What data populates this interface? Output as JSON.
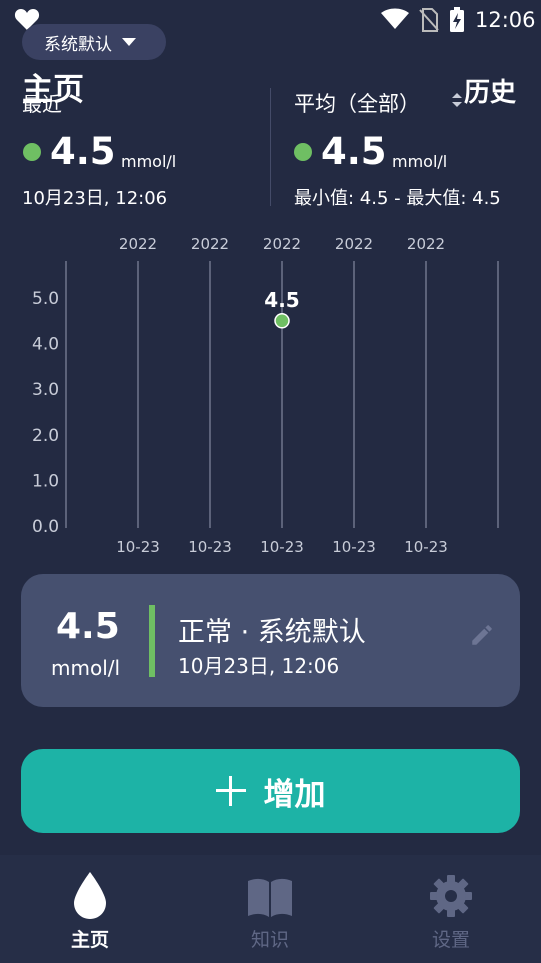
{
  "status_bar": {
    "time": "12:06"
  },
  "unit_chip": {
    "label": "系统默认"
  },
  "header": {
    "title": "主页",
    "recent_label": "最近",
    "average_label": "平均（全部）",
    "history_label": "历史"
  },
  "recent": {
    "value": "4.5",
    "unit": "mmol/l",
    "timestamp": "10月23日, 12:06"
  },
  "average": {
    "value": "4.5",
    "unit": "mmol/l",
    "range": "最小值: 4.5 - 最大值: 4.5"
  },
  "chart_data": {
    "type": "scatter",
    "y_ticks": [
      "5.0",
      "4.0",
      "3.0",
      "2.0",
      "1.0",
      "0.0"
    ],
    "ylim": [
      0,
      5.5
    ],
    "x_ticks_top": [
      "2022",
      "2022",
      "2022",
      "2022",
      "2022"
    ],
    "x_ticks_bottom": [
      "10-23",
      "10-23",
      "10-23",
      "10-23",
      "10-23"
    ],
    "points": [
      {
        "x_index": 2,
        "y": 4.5,
        "label": "4.5"
      }
    ],
    "grid": true,
    "colors": {
      "point": "#6fbf63",
      "grid": "#7c8197",
      "axis_text": "#c8ccd8"
    }
  },
  "latest_card": {
    "value": "4.5",
    "unit": "mmol/l",
    "status": "正常 · 系统默认",
    "timestamp": "10月23日, 12:06"
  },
  "add_button": {
    "label": "增加"
  },
  "nav": {
    "items": [
      {
        "label": "主页",
        "icon": "drop-icon"
      },
      {
        "label": "知识",
        "icon": "book-icon"
      },
      {
        "label": "设置",
        "icon": "gear-icon"
      }
    ]
  },
  "colors": {
    "background": "#232a42",
    "accent_green": "#6fbf63",
    "accent_teal": "#1db3a6",
    "card": "#46506f"
  }
}
